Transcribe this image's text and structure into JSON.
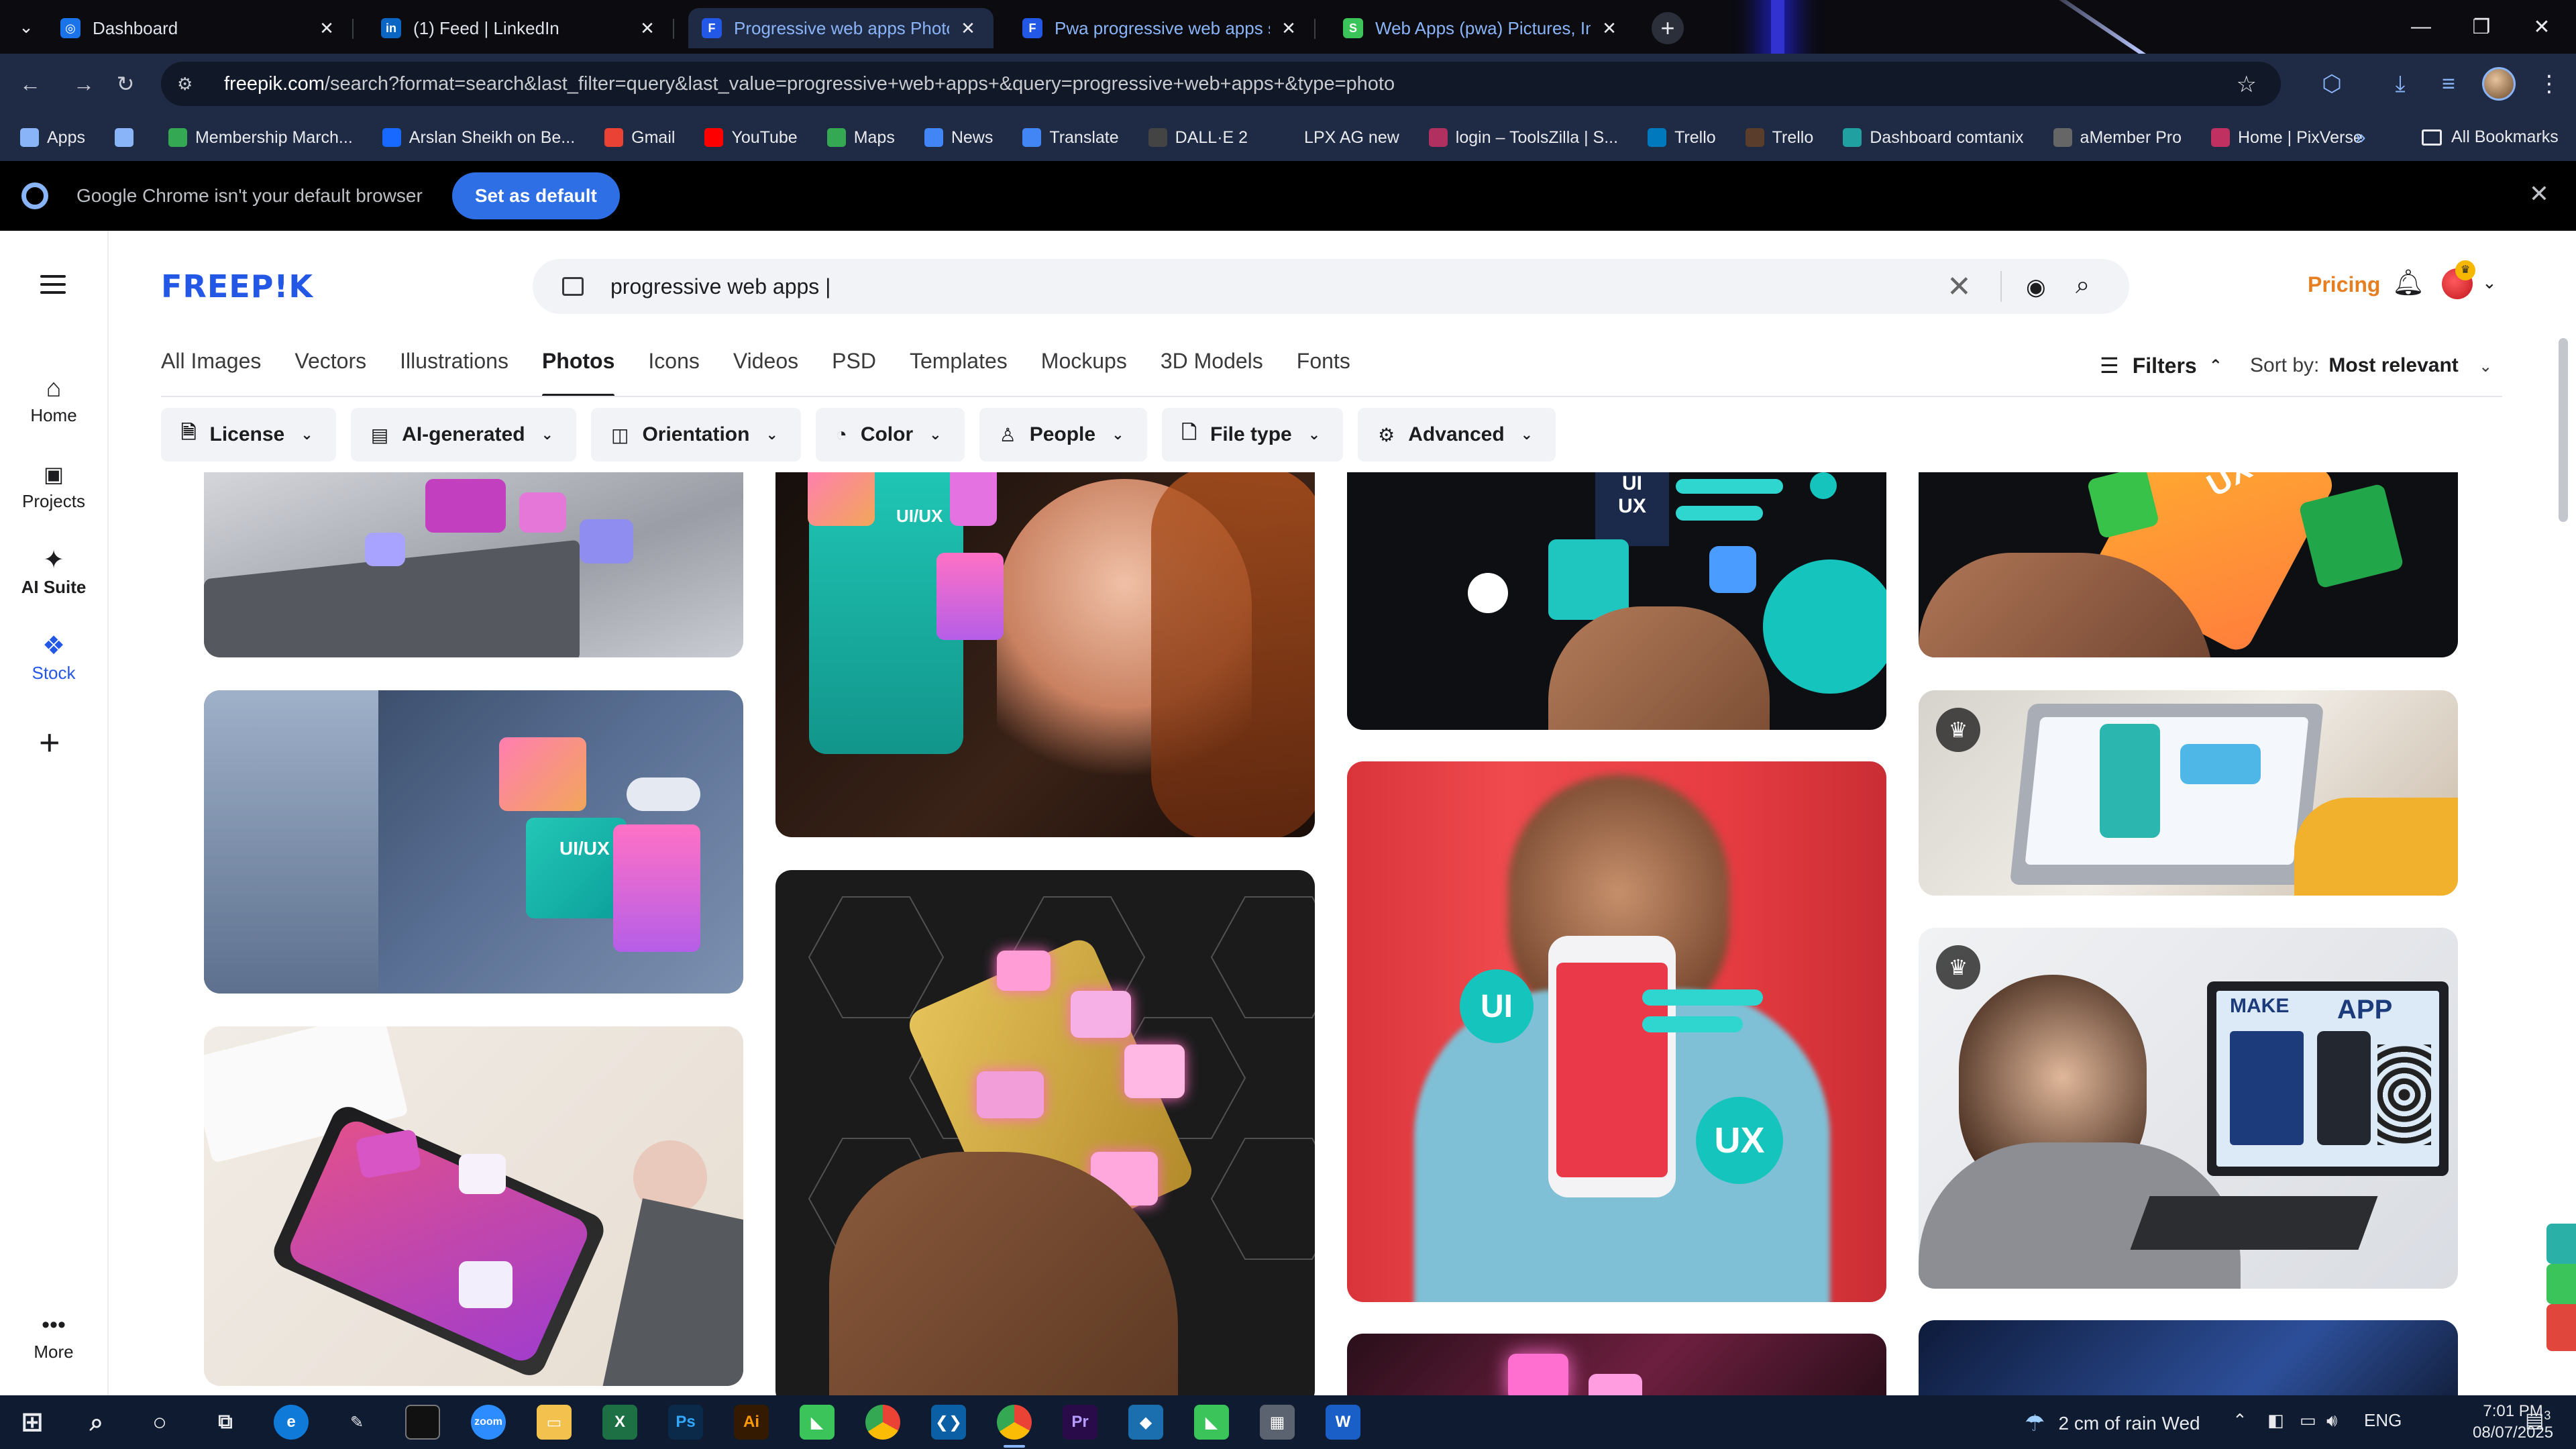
{
  "browser": {
    "tabs": [
      {
        "label": "Dashboard",
        "favicon": "dashboard-favicon",
        "fav_text": "◎",
        "fav_color": "#1a73e8",
        "active": false
      },
      {
        "label": "(1) Feed | LinkedIn",
        "favicon": "linkedin-favicon",
        "fav_text": "in",
        "fav_color": "#0a66c2",
        "active": false
      },
      {
        "label": "Progressive web apps Photos | Fr",
        "favicon": "freepik-favicon",
        "fav_text": "F",
        "fav_color": "#2357e6",
        "active": true
      },
      {
        "label": "Pwa progressive web apps sma",
        "favicon": "freepik-favicon",
        "fav_text": "F",
        "fav_color": "#2357e6",
        "active": false
      },
      {
        "label": "Web Apps (pwa) Pictures, Imag",
        "favicon": "green-favicon",
        "fav_text": "S",
        "fav_color": "#3ac45a",
        "active": false
      }
    ],
    "url_host": "freepik.com",
    "url_rest": "/search?format=search&last_filter=query&last_value=progressive+web+apps+&query=progressive+web+apps+&type=photo",
    "bookmarks": [
      {
        "label": "Apps",
        "icon": "apps-grid-icon",
        "color": "#8ab4f8"
      },
      {
        "label": "",
        "icon": "grid-icon",
        "color": "#8ab4f8"
      },
      {
        "label": "Membership March...",
        "icon": "membership-icon",
        "color": "#34a853"
      },
      {
        "label": "Arslan Sheikh on Be...",
        "icon": "behance-icon",
        "color": "#1769ff"
      },
      {
        "label": "Gmail",
        "icon": "gmail-icon",
        "color": "#ea4335"
      },
      {
        "label": "YouTube",
        "icon": "youtube-icon",
        "color": "#ff0000"
      },
      {
        "label": "Maps",
        "icon": "maps-icon",
        "color": "#34a853"
      },
      {
        "label": "News",
        "icon": "news-icon",
        "color": "#4285f4"
      },
      {
        "label": "Translate",
        "icon": "translate-icon",
        "color": "#4285f4"
      },
      {
        "label": "DALL·E 2",
        "icon": "openai-icon",
        "color": "#444444"
      },
      {
        "label": "LPX AG new",
        "icon": "lpx-icon",
        "color": "#1f2a44"
      },
      {
        "label": "login – ToolsZilla | S...",
        "icon": "toolszilla-icon",
        "color": "#b03060"
      },
      {
        "label": "Trello",
        "icon": "trello-icon",
        "color": "#0079bf"
      },
      {
        "label": "Trello",
        "icon": "trello-icon",
        "color": "#5a3e2b"
      },
      {
        "label": "Dashboard comtanix",
        "icon": "comtanix-icon",
        "color": "#20a0a0"
      },
      {
        "label": "aMember Pro",
        "icon": "amember-icon",
        "color": "#666666"
      },
      {
        "label": "Home | PixVerse",
        "icon": "pixverse-icon",
        "color": "#c03060"
      }
    ],
    "all_bookmarks": "All Bookmarks",
    "infobar_message": "Google Chrome isn't your default browser",
    "infobar_button": "Set as default"
  },
  "freepik": {
    "logo": "FREEP!K",
    "rail": [
      {
        "label": "Home",
        "icon": "home-icon",
        "glyph": "⌂",
        "active": false
      },
      {
        "label": "Projects",
        "icon": "projects-icon",
        "glyph": "▣",
        "active": false
      },
      {
        "label": "AI Suite",
        "icon": "ai-suite-icon",
        "glyph": "✦",
        "active": false
      },
      {
        "label": "Stock",
        "icon": "stock-icon",
        "glyph": "❖",
        "active": true
      }
    ],
    "more_label": "More",
    "search_value": "progressive web apps |",
    "pricing": "Pricing",
    "categories": [
      "All Images",
      "Vectors",
      "Illustrations",
      "Photos",
      "Icons",
      "Videos",
      "PSD",
      "Templates",
      "Mockups",
      "3D Models",
      "Fonts"
    ],
    "active_category": "Photos",
    "filters_label": "Filters",
    "sort_label": "Sort by:",
    "sort_value": "Most relevant",
    "chips": [
      {
        "label": "License",
        "icon": "license-icon",
        "glyph": "🗎"
      },
      {
        "label": "AI-generated",
        "icon": "ai-generated-icon",
        "glyph": "▤"
      },
      {
        "label": "Orientation",
        "icon": "orientation-icon",
        "glyph": "◫"
      },
      {
        "label": "Color",
        "icon": "palette-icon",
        "glyph": "◔"
      },
      {
        "label": "People",
        "icon": "people-icon",
        "glyph": "♙"
      },
      {
        "label": "File type",
        "icon": "file-type-icon",
        "glyph": "🗋"
      },
      {
        "label": "Advanced",
        "icon": "advanced-settings-icon",
        "glyph": "⚙"
      }
    ],
    "image_texts": {
      "uiux_1": "UI/UX",
      "uiux_2": "UI/UX",
      "ui_ux_stack_ui": "UI",
      "ui_ux_stack_ux": "UX",
      "ui": "UI",
      "ux": "UX",
      "ux_phone": "UX",
      "make_app": "MAKE",
      "app": "APP"
    }
  },
  "taskbar": {
    "weather": "2 cm of rain Wed",
    "language": "ENG",
    "time": "7:01 PM",
    "date": "08/07/2025",
    "notifications": "3"
  }
}
